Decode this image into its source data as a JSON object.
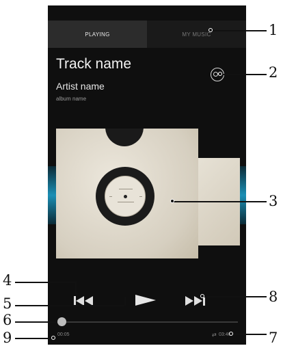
{
  "tabs": [
    {
      "label": "PLAYING",
      "active": true
    },
    {
      "label": "MY MUSIC",
      "active": false
    }
  ],
  "track": {
    "name": "Track name",
    "artist": "Artist name",
    "album": "album name"
  },
  "playback": {
    "elapsed": "00:05",
    "total": "03:46",
    "progress_fraction": 0.02
  },
  "icons": {
    "share": "share-icon",
    "prev": "previous-icon",
    "play": "play-icon",
    "next": "next-icon",
    "repeat": "repeat-icon"
  },
  "callouts": [
    "1",
    "2",
    "3",
    "4",
    "5",
    "6",
    "7",
    "8",
    "9"
  ],
  "colors": {
    "background": "#0f0f0f",
    "accent_glow": "#1b8fb5",
    "text": "#f2f2f2"
  }
}
